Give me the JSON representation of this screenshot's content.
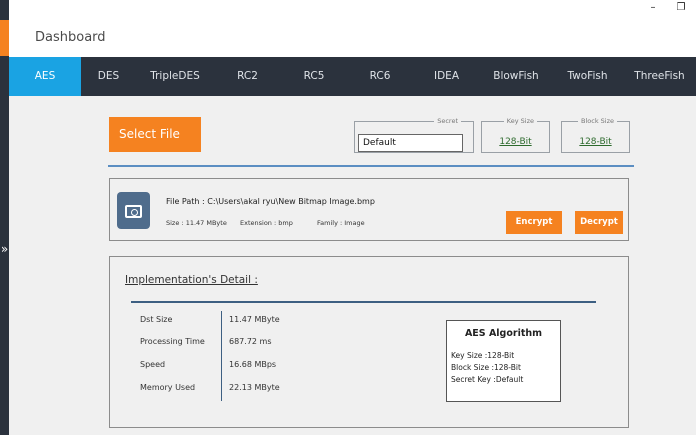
{
  "window": {
    "minimize": "–",
    "maximize": "❐"
  },
  "app": {
    "title": "Dashboard"
  },
  "rail": {
    "expand_glyph": "»"
  },
  "tabs": [
    "AES",
    "DES",
    "TripleDES",
    "RC2",
    "RC5",
    "RC6",
    "IDEA",
    "BlowFish",
    "TwoFish",
    "ThreeFish"
  ],
  "active_tab": "AES",
  "toolbar": {
    "select_file_label": "Select File",
    "secret_legend": "Secret",
    "secret_value": "Default",
    "key_size_legend": "Key Size",
    "key_size_value": "128-Bit",
    "block_size_legend": "Block Size",
    "block_size_value": "128-Bit"
  },
  "file": {
    "path_label": "File Path :",
    "path_value": "C:\\Users\\akal ryu\\New Bitmap Image.bmp",
    "size_label": "Size :",
    "size_value": "11.47 MByte",
    "extension_label": "Extension :",
    "extension_value": "bmp",
    "family_label": "Family :",
    "family_value": "Image",
    "encrypt_label": "Encrypt",
    "decrypt_label": "Decrypt",
    "icon": "image-file-icon"
  },
  "details": {
    "title": "Implementation's Detail :",
    "metrics": [
      {
        "label": "Dst Size",
        "value": "11.47 MByte"
      },
      {
        "label": "Processing Time",
        "value": "687.72 ms"
      },
      {
        "label": "Speed",
        "value": "16.68 MBps"
      },
      {
        "label": "Memory Used",
        "value": "22.13 MByte"
      }
    ],
    "algorithm": {
      "title": "AES Algorithm",
      "key_size": "Key Size :128-Bit",
      "block_size": "Block Size :128-Bit",
      "secret_key": "Secret Key :Default"
    }
  },
  "colors": {
    "accent_orange": "#f58220",
    "active_tab_blue": "#1aa3e3",
    "tabbar_dark": "#2b323d",
    "separator_blue": "#5b8ec2"
  }
}
